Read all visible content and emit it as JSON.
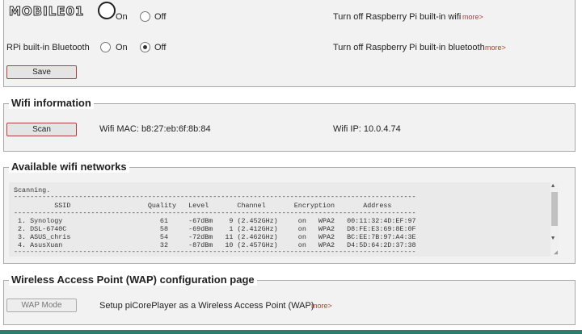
{
  "logo": {
    "text": "MOBILE01"
  },
  "wifi_row": {
    "on_label": "On",
    "off_label": "Off",
    "description": "Turn off Raspberry Pi built-in wifi",
    "more": "more>",
    "selected": "off"
  },
  "bt_row": {
    "label": "RPi built-in Bluetooth",
    "on_label": "On",
    "off_label": "Off",
    "description": "Turn off Raspberry Pi built-in bluetooth",
    "more": "more>",
    "selected": "off"
  },
  "save_label": "Save",
  "wifi_info": {
    "legend": "Wifi information",
    "scan_label": "Scan",
    "mac": "Wifi MAC: b8:27:eb:6f:8b:84",
    "ip": "Wifi IP: 10.0.4.74"
  },
  "networks": {
    "legend": "Available wifi networks",
    "lines": [
      "Scanning.",
      "---------------------------------------------------------------------------------------------------",
      "          SSID                   Quality   Level       Channel       Encryption       Address",
      "---------------------------------------------------------------------------------------------------",
      " 1. Synology                        61     -67dBm    9 (2.452GHz)     on   WPA2   00:11:32:4D:EF:97",
      " 2. DSL-6740C                       58     -69dBm    1 (2.412GHz)     on   WPA2   D8:FE:E3:69:8E:0F",
      " 3. ASUS_chris                      54     -72dBm   11 (2.462GHz)     on   WPA2   BC:EE:7B:97:A4:3E",
      " 4. AsusXuan                        32     -87dBm   10 (2.457GHz)     on   WPA2   D4:5D:64:2D:37:38",
      "---------------------------------------------------------------------------------------------------"
    ]
  },
  "wap": {
    "legend": "Wireless Access Point (WAP) configuration page",
    "button_label": "WAP Mode",
    "description": "Setup piCorePlayer as a Wireless Access Point (WAP)",
    "more": "more>"
  }
}
